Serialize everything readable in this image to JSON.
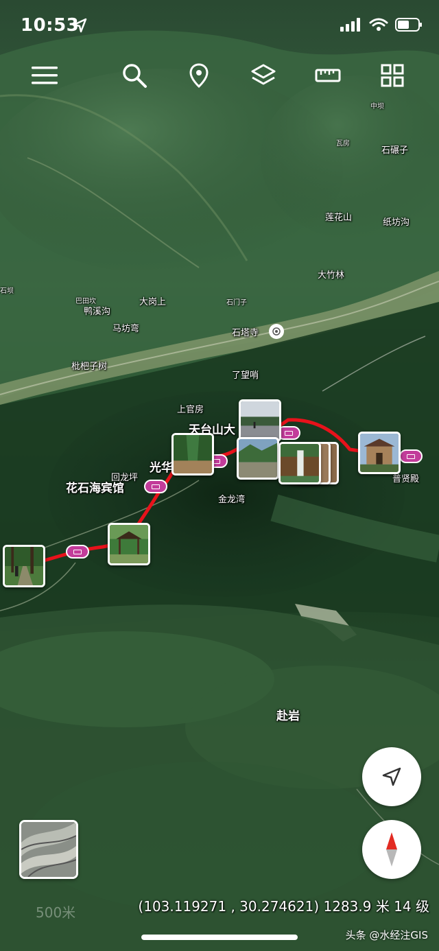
{
  "status": {
    "time": "10:53"
  },
  "toolbar": {
    "menu": "menu-icon",
    "search": "search-icon",
    "place": "location-pin-icon",
    "layers": "layers-icon",
    "measure": "ruler-icon",
    "projects": "grid-icon"
  },
  "map": {
    "labels_major": [
      "天台山大",
      "光华",
      "花石海宾馆",
      "赴岩"
    ],
    "labels_medium": [
      "石塔寺",
      "了望哨",
      "上官房",
      "金龙湾",
      "枇杷子树",
      "大竹林",
      "莲花山",
      "纸坊沟",
      "大岗上",
      "鸭溪沟",
      "马坊弯",
      "石碾子",
      "回龙坪",
      "普贤殿"
    ],
    "labels_small": [
      "中坝",
      "巴田坎",
      "石门子",
      "石坝",
      "瓦房"
    ]
  },
  "route": {
    "color": "#e8121b"
  },
  "photos": [
    "photo-forest-trail",
    "photo-pavilion",
    "photo-gorge-stream",
    "photo-parking-plaza",
    "photo-river-valley",
    "photo-waterfall",
    "photo-temple-gate"
  ],
  "controls": {
    "locate": "navigation-arrow-icon",
    "compass": "compass-icon",
    "map_style": "map-style-thumbnail"
  },
  "readout": {
    "coordinates": "(103.119271 , 30.274621) 1283.9 米 14 级",
    "scale": "500米"
  },
  "watermark": "头条 @水经注GIS"
}
